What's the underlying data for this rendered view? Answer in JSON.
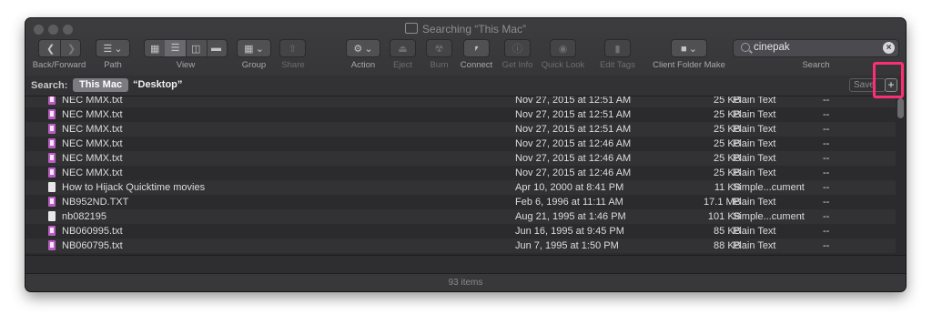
{
  "window": {
    "title": "Searching “This Mac”"
  },
  "toolbar": {
    "back_forward_label": "Back/Forward",
    "path_label": "Path",
    "view_label": "View",
    "group_label": "Group",
    "share_label": "Share",
    "action_label": "Action",
    "eject_label": "Eject",
    "burn_label": "Burn",
    "connect_label": "Connect",
    "get_info_label": "Get Info",
    "quick_look_label": "Quick Look",
    "edit_tags_label": "Edit Tags",
    "client_folder_label": "Client Folder Make",
    "search_label": "Search",
    "search_value": "cinepak"
  },
  "scope": {
    "label": "Search:",
    "this_mac": "This Mac",
    "desktop": "“Desktop”",
    "save_label": "Save",
    "plus_label": "+"
  },
  "rows": [
    {
      "name": "NEC MMX.txt",
      "date": "Nov 27, 2015 at 12:51 AM",
      "size": "25 KB",
      "kind": "Plain Text",
      "tags": "--",
      "icon": "text-file-icon"
    },
    {
      "name": "NEC MMX.txt",
      "date": "Nov 27, 2015 at 12:51 AM",
      "size": "25 KB",
      "kind": "Plain Text",
      "tags": "--",
      "icon": "text-file-icon"
    },
    {
      "name": "NEC MMX.txt",
      "date": "Nov 27, 2015 at 12:51 AM",
      "size": "25 KB",
      "kind": "Plain Text",
      "tags": "--",
      "icon": "text-file-icon"
    },
    {
      "name": "NEC MMX.txt",
      "date": "Nov 27, 2015 at 12:46 AM",
      "size": "25 KB",
      "kind": "Plain Text",
      "tags": "--",
      "icon": "text-file-icon"
    },
    {
      "name": "NEC MMX.txt",
      "date": "Nov 27, 2015 at 12:46 AM",
      "size": "25 KB",
      "kind": "Plain Text",
      "tags": "--",
      "icon": "text-file-icon"
    },
    {
      "name": "NEC MMX.txt",
      "date": "Nov 27, 2015 at 12:46 AM",
      "size": "25 KB",
      "kind": "Plain Text",
      "tags": "--",
      "icon": "text-file-icon"
    },
    {
      "name": "How to Hijack Quicktime movies",
      "date": "Apr 10, 2000 at 8:41 PM",
      "size": "11 KB",
      "kind": "Simple...cument",
      "tags": "--",
      "icon": "document-icon"
    },
    {
      "name": "NB952ND.TXT",
      "date": "Feb 6, 1996 at 11:11 AM",
      "size": "17.1 MB",
      "kind": "Plain Text",
      "tags": "--",
      "icon": "text-file-icon"
    },
    {
      "name": "nb082195",
      "date": "Aug 21, 1995 at 1:46 PM",
      "size": "101 KB",
      "kind": "Simple...cument",
      "tags": "--",
      "icon": "document-icon"
    },
    {
      "name": "NB060995.txt",
      "date": "Jun 16, 1995 at 9:45 PM",
      "size": "85 KB",
      "kind": "Plain Text",
      "tags": "--",
      "icon": "text-file-icon"
    },
    {
      "name": "NB060795.txt",
      "date": "Jun 7, 1995 at 1:50 PM",
      "size": "88 KB",
      "kind": "Plain Text",
      "tags": "--",
      "icon": "text-file-icon"
    }
  ],
  "status": {
    "item_count": "93 items"
  },
  "colors": {
    "highlight": "#ff2d73",
    "window_bg": "#2b2b2d",
    "text_file_icon": "#b95cc4"
  }
}
